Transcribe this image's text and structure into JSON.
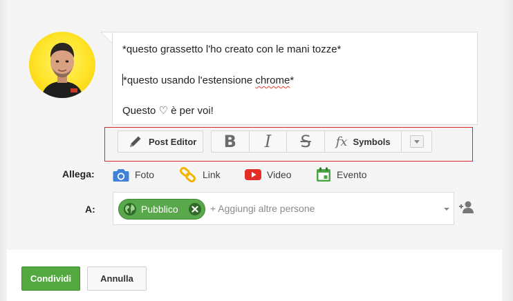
{
  "editor": {
    "lines": [
      "*questo grassetto l'ho creato con  le mani tozze*",
      "*questo usando l'estensione ",
      "Questo ♡ è per voi!"
    ],
    "line2_misspelled": "chrome",
    "line2_end": "*"
  },
  "toolbar": {
    "post_editor_label": "Post Editor",
    "bold_glyph": "B",
    "italic_glyph": "I",
    "strike_glyph": "S",
    "fx_glyph": "fx",
    "symbols_label": "Symbols",
    "frame_color": "#d8252b"
  },
  "attach": {
    "label": "Allega:",
    "items": [
      {
        "label": "Foto",
        "icon": "camera-icon",
        "color": "#3f82d7"
      },
      {
        "label": "Link",
        "icon": "link-icon",
        "color": "#f2b400"
      },
      {
        "label": "Video",
        "icon": "youtube-icon",
        "color": "#e52d27"
      },
      {
        "label": "Evento",
        "icon": "calendar-icon",
        "color": "#4aa544"
      }
    ]
  },
  "share": {
    "label": "A:",
    "chip_label": "Pubblico",
    "placeholder": "+ Aggiungi altre persone",
    "chip_color": "#59a84b"
  },
  "actions": {
    "share_label": "Condividi",
    "cancel_label": "Annulla",
    "share_color": "#53a93f"
  }
}
